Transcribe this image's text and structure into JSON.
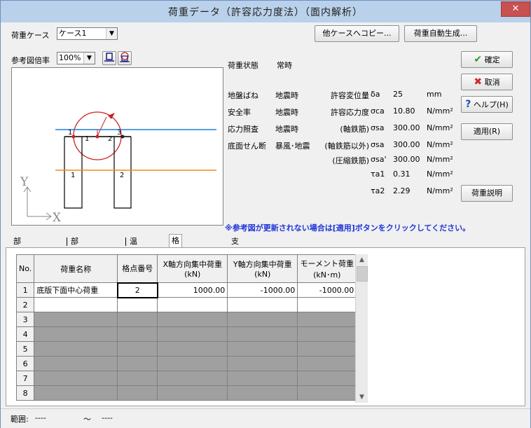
{
  "window": {
    "title": "荷重データ（許容応力度法）（面内解析）",
    "close": "✕"
  },
  "load_case": {
    "label": "荷重ケース",
    "value": "ケース1"
  },
  "buttons": {
    "copy_other": "他ケースへコピー...",
    "auto_generate": "荷重自動生成...",
    "confirm": "確定",
    "cancel": "取消",
    "help": "ヘルプ(H)",
    "apply": "適用(R)",
    "load_desc": "荷重説明"
  },
  "zoom": {
    "label": "参考図倍率",
    "value": "100%"
  },
  "diagram": {
    "axis_y": "Y",
    "axis_x": "X",
    "nodes": [
      "1",
      "1",
      "2",
      "3"
    ],
    "members": [
      "1",
      "2"
    ]
  },
  "load_info": {
    "state_label": "荷重状態",
    "state_value": "常時",
    "rows": [
      {
        "c1": "地盤ばね",
        "c2": "地震時",
        "c3": "許容変位量",
        "sym": "δa",
        "val": "25",
        "unit": "mm"
      },
      {
        "c1": "安全率",
        "c2": "地震時",
        "c3": "許容応力度",
        "sym": "σca",
        "val": "10.80",
        "unit": "N/mm²"
      },
      {
        "c1": "応力照査",
        "c2": "地震時",
        "c3": "(軸鉄筋)",
        "sym": "σsa",
        "val": "300.00",
        "unit": "N/mm²"
      },
      {
        "c1": "底面せん断",
        "c2": "暴風･地震",
        "c3": "(軸鉄筋以外)",
        "sym": "σsa",
        "val": "300.00",
        "unit": "N/mm²"
      },
      {
        "c1": "",
        "c2": "",
        "c3": "(圧縮鉄筋)",
        "sym": "σsa'",
        "val": "300.00",
        "unit": "N/mm²"
      },
      {
        "c1": "",
        "c2": "",
        "c3": "",
        "sym": "τa1",
        "val": "0.31",
        "unit": "N/mm²"
      },
      {
        "c1": "",
        "c2": "",
        "c3": "",
        "sym": "τa2",
        "val": "2.29",
        "unit": "N/mm²"
      }
    ]
  },
  "notice": "※参考図が更新されない場合は[適用]ボタンをクリックしてください。",
  "tabs": [
    "部材分布荷重",
    "部材集中荷重",
    "温度荷重",
    "格点集中荷重",
    "支点強制変位"
  ],
  "table": {
    "headers": [
      {
        "l1": "No.",
        "l2": ""
      },
      {
        "l1": "荷重名称",
        "l2": ""
      },
      {
        "l1": "格点番号",
        "l2": ""
      },
      {
        "l1": "X軸方向集中荷重",
        "l2": "(kN)"
      },
      {
        "l1": "Y軸方向集中荷重",
        "l2": "(kN)"
      },
      {
        "l1": "モーメント荷重",
        "l2": "(kN･m)"
      }
    ],
    "rows": [
      {
        "no": "1",
        "name": "底版下面中心荷重",
        "node": "2",
        "fx": "1000.00",
        "fy": "-1000.00",
        "m": "-1000.00"
      },
      {
        "no": "2",
        "name": "",
        "node": "",
        "fx": "",
        "fy": "",
        "m": ""
      },
      {
        "no": "3",
        "name": "",
        "node": "",
        "fx": "",
        "fy": "",
        "m": ""
      },
      {
        "no": "4",
        "name": "",
        "node": "",
        "fx": "",
        "fy": "",
        "m": ""
      },
      {
        "no": "5",
        "name": "",
        "node": "",
        "fx": "",
        "fy": "",
        "m": ""
      },
      {
        "no": "6",
        "name": "",
        "node": "",
        "fx": "",
        "fy": "",
        "m": ""
      },
      {
        "no": "7",
        "name": "",
        "node": "",
        "fx": "",
        "fy": "",
        "m": ""
      },
      {
        "no": "8",
        "name": "",
        "node": "",
        "fx": "",
        "fy": "",
        "m": ""
      }
    ]
  },
  "status": {
    "range_label": "範囲:",
    "from": "----",
    "tilde": "〜",
    "to": "----"
  },
  "colors": {
    "confirm_check": "#2e9a2e",
    "cancel_x": "#cc2a2a",
    "help_q": "#1e4fb4",
    "notice": "#1f35d8",
    "blue_line": "#1e7fd6",
    "orange_line": "#f08a1c",
    "moment_red": "#cc2020"
  }
}
